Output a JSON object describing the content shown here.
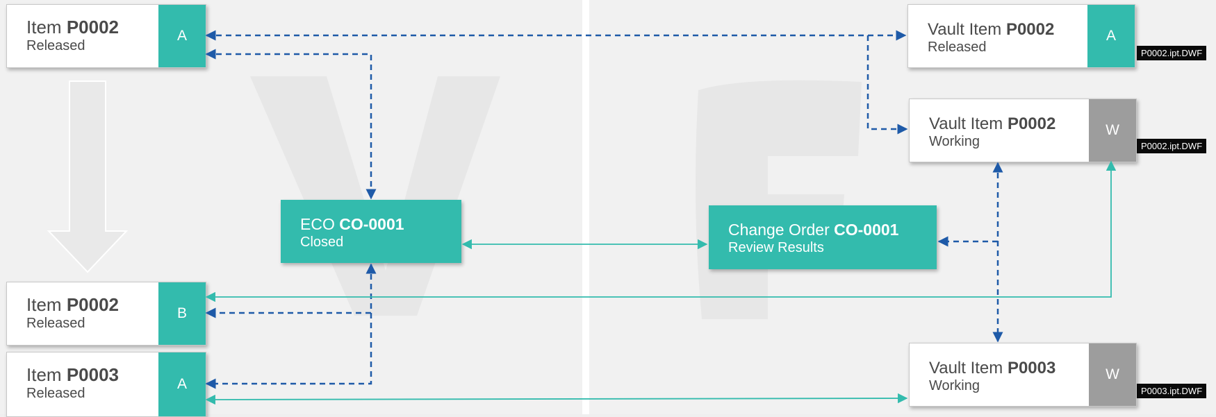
{
  "colors": {
    "teal": "#33bbad",
    "blue": "#1e5aa8",
    "gray_rev": "#9d9d9d"
  },
  "items": {
    "p0002_a": {
      "prefix": "Item",
      "number": "P0002",
      "state": "Released",
      "rev": "A"
    },
    "p0002_b": {
      "prefix": "Item",
      "number": "P0002",
      "state": "Released",
      "rev": "B"
    },
    "p0003_a": {
      "prefix": "Item",
      "number": "P0003",
      "state": "Released",
      "rev": "A"
    }
  },
  "eco": {
    "prefix": "ECO",
    "number": "CO-0001",
    "state": "Closed"
  },
  "change_order": {
    "prefix": "Change Order",
    "number": "CO-0001",
    "state": "Review Results"
  },
  "vault": {
    "p0002_released": {
      "prefix": "Vault Item",
      "number": "P0002",
      "state": "Released",
      "rev": "A",
      "file": "P0002.ipt.DWF"
    },
    "p0002_working": {
      "prefix": "Vault Item",
      "number": "P0002",
      "state": "Working",
      "rev": "W",
      "file": "P0002.ipt.DWF"
    },
    "p0003_working": {
      "prefix": "Vault Item",
      "number": "P0003",
      "state": "Working",
      "rev": "W",
      "file": "P0003.ipt.DWF"
    }
  }
}
